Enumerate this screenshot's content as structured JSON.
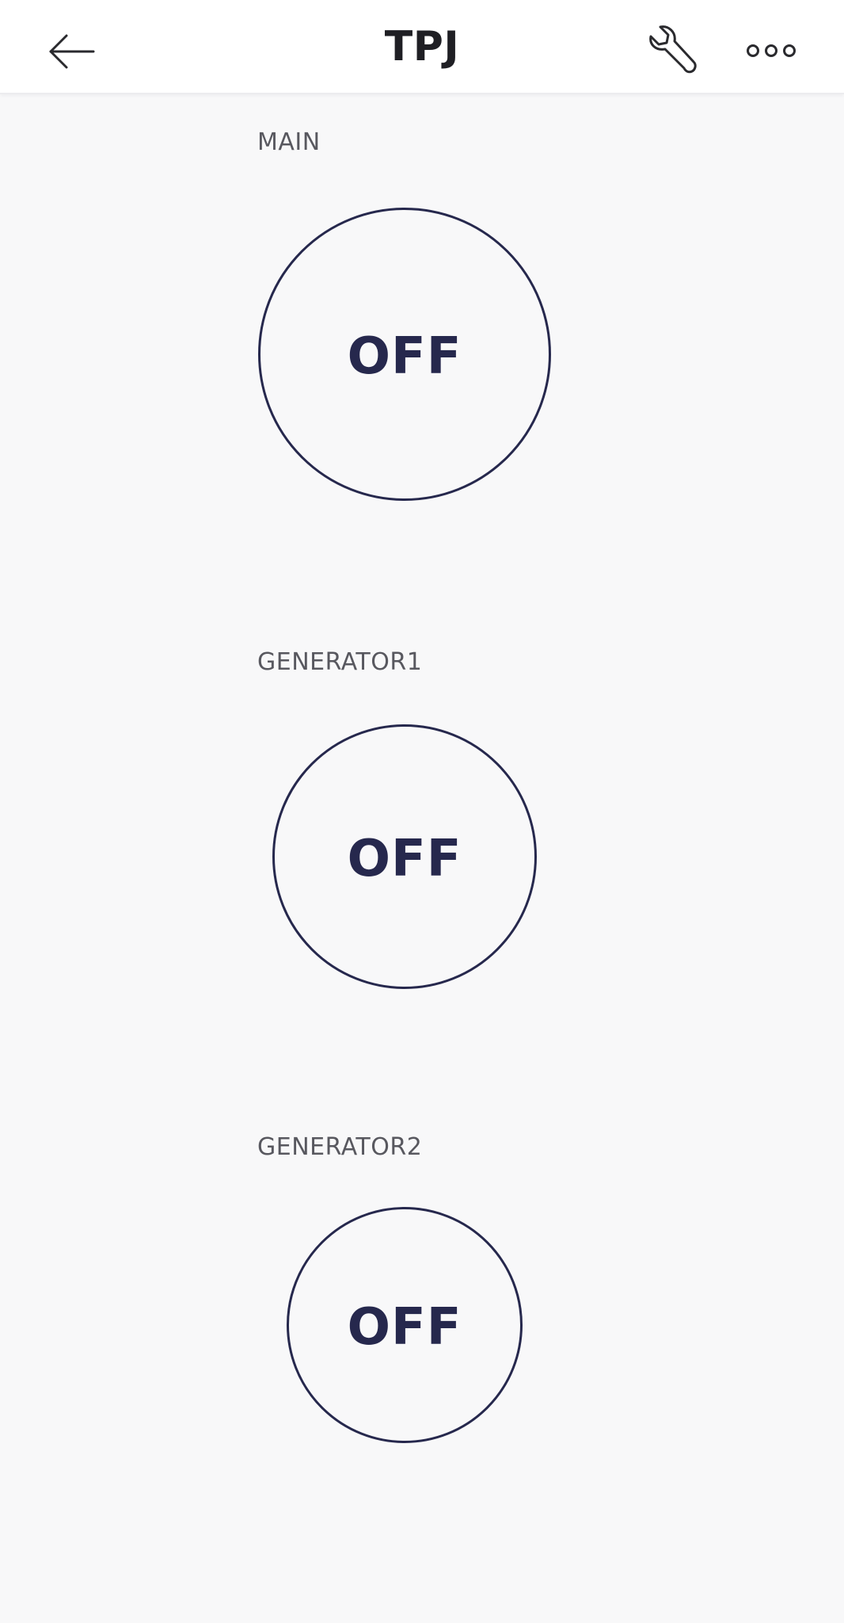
{
  "header": {
    "title": "TPJ",
    "back_icon": "arrow-left-icon",
    "settings_icon": "wrench-icon",
    "more_icon": "more-horizontal-icon"
  },
  "switches": [
    {
      "label": "MAIN",
      "state": "OFF"
    },
    {
      "label": "GENERATOR1",
      "state": "OFF"
    },
    {
      "label": "GENERATOR2",
      "state": "OFF"
    }
  ],
  "colors": {
    "background": "#f8f8f9",
    "header_background": "#ffffff",
    "accent": "#26284d",
    "label": "#58585f",
    "title": "#1f1f24"
  }
}
